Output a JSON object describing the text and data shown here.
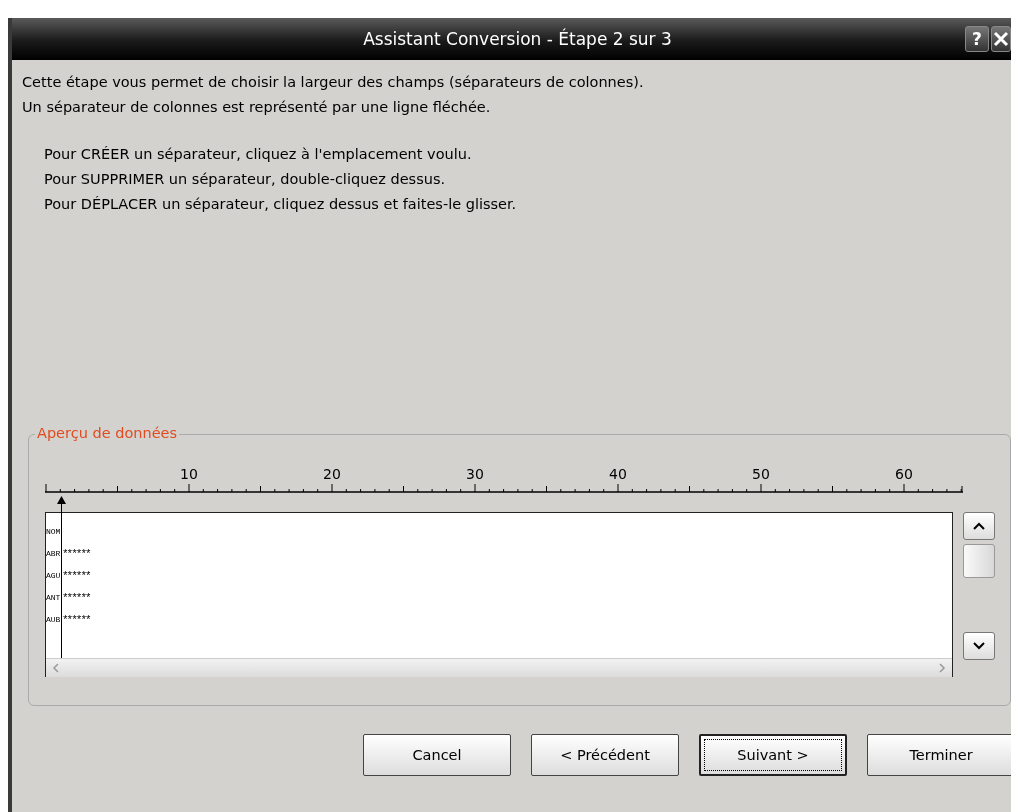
{
  "window": {
    "title": "Assistant Conversion - Étape 2 sur 3",
    "help": "?"
  },
  "intro": [
    "Cette étape vous permet de choisir la largeur des champs (séparateurs de colonnes).",
    "Un séparateur de colonnes est représenté par une ligne fléchée."
  ],
  "instructions": [
    "Pour CRÉER un séparateur, cliquez à l'emplacement voulu.",
    "Pour SUPPRIMER un séparateur, double-cliquez dessus.",
    "Pour DÉPLACER un séparateur, cliquez dessus et faites-le glisser."
  ],
  "preview": {
    "title": "Aperçu de données",
    "ruler_labels": [
      "10",
      "20",
      "30",
      "40",
      "50",
      "60"
    ],
    "rows": [
      [
        "NOM"
      ],
      [
        "ABR",
        "******"
      ],
      [
        "AGU",
        "******"
      ],
      [
        "ANT",
        "******"
      ],
      [
        "AUB",
        "******"
      ]
    ]
  },
  "buttons": [
    {
      "label": "Cancel",
      "focused": false
    },
    {
      "label": "< Précédent",
      "focused": false
    },
    {
      "label": "Suivant >",
      "focused": true
    },
    {
      "label": "Terminer",
      "focused": false
    }
  ]
}
